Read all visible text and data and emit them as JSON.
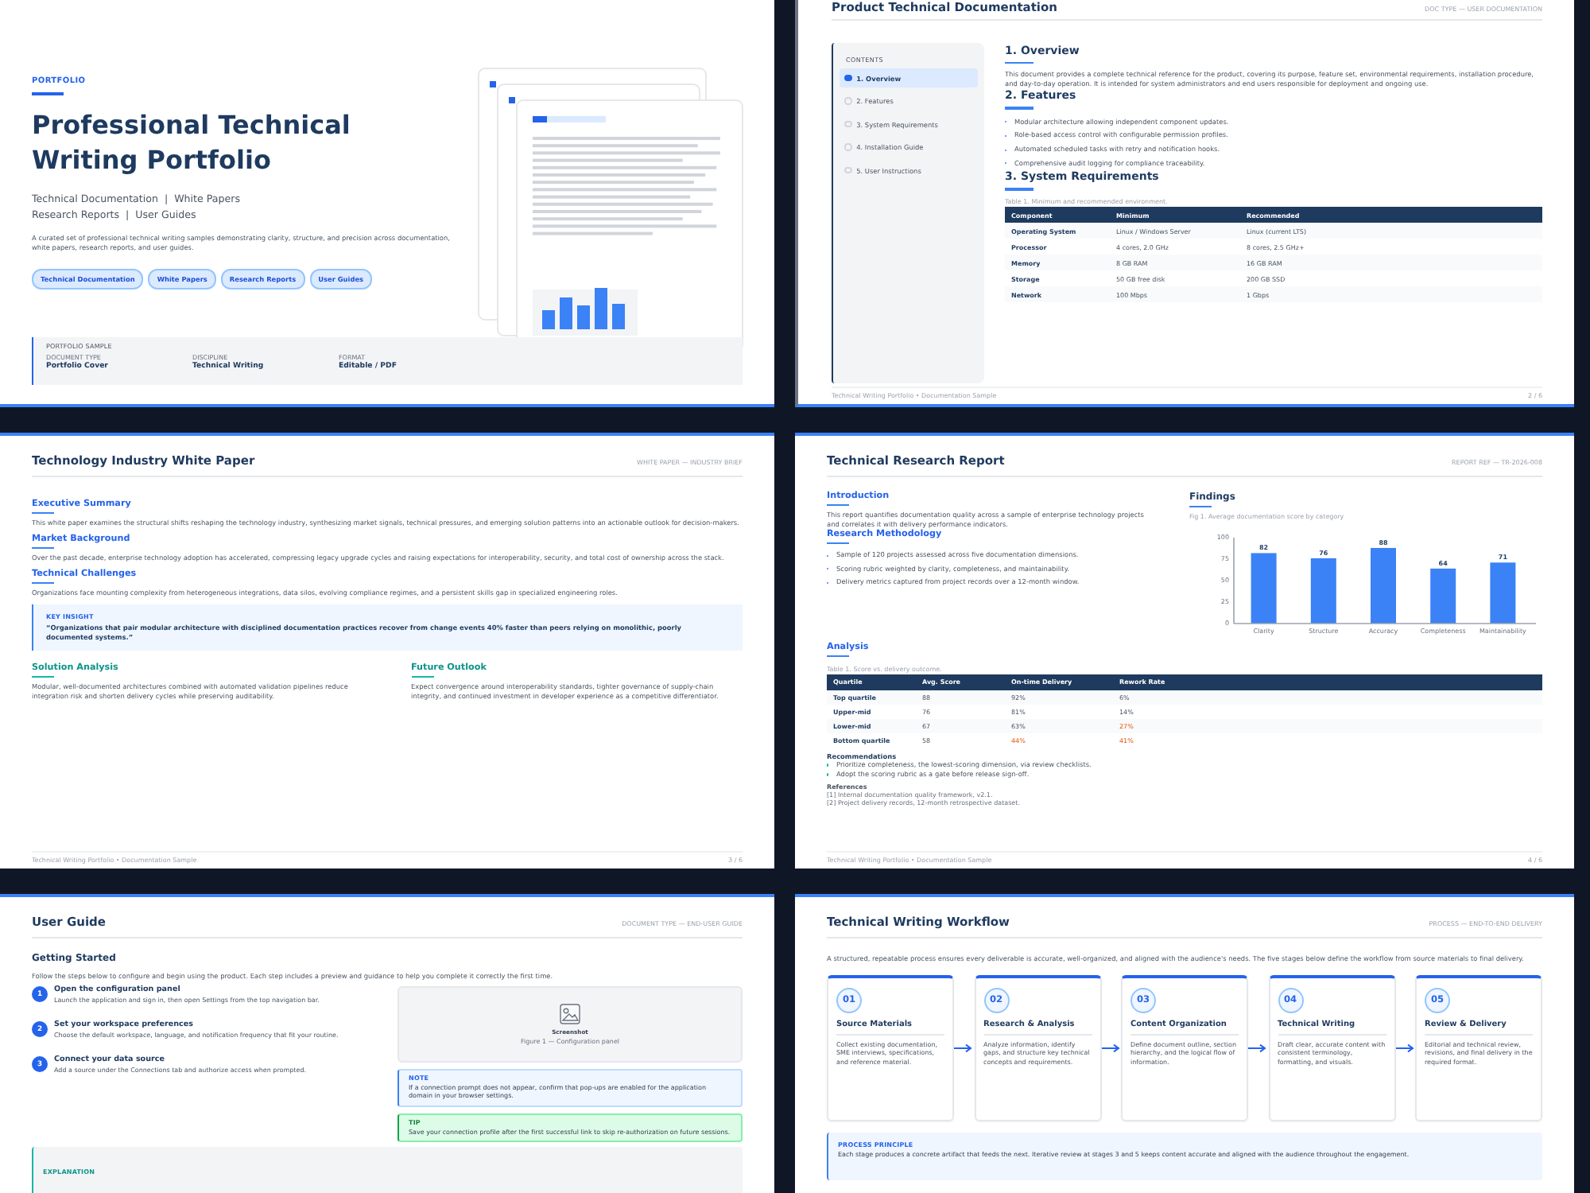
{
  "cover": {
    "eyebrow": "PORTFOLIO",
    "title": "Professional Technical Writing Portfolio",
    "subtitle_lines": [
      "Technical Documentation  |  White Papers",
      "Research Reports  |  User Guides"
    ],
    "description": "A curated set of professional technical writing samples demonstrating clarity, structure, and precision across documentation, white papers, research reports, and user guides.",
    "tags": [
      "Technical Documentation",
      "White Papers",
      "Research Reports",
      "User Guides"
    ],
    "sample": {
      "label": "PORTFOLIO SAMPLE",
      "fields": [
        {
          "label": "DOCUMENT TYPE",
          "value": "Portfolio Cover"
        },
        {
          "label": "DISCIPLINE",
          "value": "Technical Writing"
        },
        {
          "label": "FORMAT",
          "value": "Editable / PDF"
        }
      ]
    }
  },
  "doc": {
    "title": "Product Technical Documentation",
    "meta": "DOC TYPE — USER DOCUMENTATION",
    "contents_label": "CONTENTS",
    "contents": [
      {
        "label": "1. Overview",
        "selected": true
      },
      {
        "label": "2. Features",
        "selected": false
      },
      {
        "label": "3. System Requirements",
        "selected": false
      },
      {
        "label": "4. Installation Guide",
        "selected": false
      },
      {
        "label": "5. User Instructions",
        "selected": false
      }
    ],
    "overview_heading": "1. Overview",
    "overview": "This document provides a complete technical reference for the product, covering its purpose, feature set, environmental requirements, installation procedure, and day-to-day operation. It is intended for system administrators and end users responsible for deployment and ongoing use.",
    "features_heading": "2. Features",
    "features": [
      "Modular architecture allowing independent component updates.",
      "Role-based access control with configurable permission profiles.",
      "Automated scheduled tasks with retry and notification hooks.",
      "Comprehensive audit logging for compliance traceability."
    ],
    "requirements_heading": "3. System Requirements",
    "table_caption": "Table 1. Minimum and recommended environment.",
    "columns": [
      "Component",
      "Minimum",
      "Recommended"
    ],
    "rows": [
      [
        "Operating System",
        "Linux / Windows Server",
        "Linux (current LTS)"
      ],
      [
        "Processor",
        "4 cores, 2.0 GHz",
        "8 cores, 2.5 GHz+"
      ],
      [
        "Memory",
        "8 GB RAM",
        "16 GB RAM"
      ],
      [
        "Storage",
        "50 GB free disk",
        "200 GB SSD"
      ],
      [
        "Network",
        "100 Mbps",
        "1 Gbps"
      ]
    ],
    "footer": {
      "left": "Technical Writing Portfolio  •  Documentation Sample",
      "right": "2 / 6"
    }
  },
  "white_paper": {
    "title": "Technology Industry White Paper",
    "meta": "WHITE PAPER — INDUSTRY BRIEF",
    "sections": [
      {
        "heading": "Executive Summary",
        "text": "This white paper examines the structural shifts reshaping the technology industry, synthesizing market signals, technical pressures, and emerging solution patterns into an actionable outlook for decision-makers."
      },
      {
        "heading": "Market Background",
        "text": "Over the past decade, enterprise technology adoption has accelerated, compressing legacy upgrade cycles and raising expectations for interoperability, security, and total cost of ownership across the stack."
      },
      {
        "heading": "Technical Challenges",
        "text": "Organizations face mounting complexity from heterogeneous integrations, data silos, evolving compliance regimes, and a persistent skills gap in specialized engineering roles."
      }
    ],
    "insight": {
      "label": "KEY INSIGHT",
      "quote": "“Organizations that pair modular architecture with disciplined documentation practices recover from change events 40% faster than peers relying on monolithic, poorly documented systems.”"
    },
    "columns": [
      {
        "heading": "Solution Analysis",
        "text": "Modular, well-documented architectures combined with automated validation pipelines reduce integration risk and shorten delivery cycles while preserving auditability."
      },
      {
        "heading": "Future Outlook",
        "text": "Expect convergence around interoperability standards, tighter governance of supply-chain integrity, and continued investment in developer experience as a competitive differentiator."
      }
    ],
    "footer": {
      "left": "Technical Writing Portfolio  •  Documentation Sample",
      "right": "3 / 6"
    }
  },
  "report": {
    "title": "Technical Research Report",
    "meta": "REPORT REF — TR-2026-008",
    "intro_heading": "Introduction",
    "intro": "This report quantifies documentation quality across a sample of enterprise technology projects and correlates it with delivery performance indicators.",
    "method_heading": "Research Methodology",
    "method": [
      "Sample of 120 projects assessed across five documentation dimensions.",
      "Scoring rubric weighted by clarity, completeness, and maintainability.",
      "Delivery metrics captured from project records over a 12-month window."
    ],
    "findings": {
      "heading": "Findings",
      "chart_data": {
        "type": "bar",
        "title": "Fig 1. Average documentation score by category",
        "categories": [
          "Clarity",
          "Structure",
          "Accuracy",
          "Completeness",
          "Maintainability"
        ],
        "values": [
          82,
          76,
          88,
          64,
          71
        ],
        "ylim": [
          0,
          100
        ],
        "yticks": [
          0,
          25,
          50,
          75,
          100
        ],
        "data_labels": true
      }
    },
    "analysis": {
      "heading": "Analysis",
      "caption": "Table 1. Score vs. delivery outcome.",
      "columns": [
        "Quartile",
        "Avg. Score",
        "On-time Delivery",
        "Rework Rate"
      ],
      "rows": [
        [
          {
            "text": "Top quartile",
            "flagged": false
          },
          {
            "text": "88",
            "flagged": false
          },
          {
            "text": "92%",
            "flagged": false
          },
          {
            "text": "6%",
            "flagged": false
          }
        ],
        [
          {
            "text": "Upper-mid",
            "flagged": false
          },
          {
            "text": "76",
            "flagged": false
          },
          {
            "text": "81%",
            "flagged": false
          },
          {
            "text": "14%",
            "flagged": false
          }
        ],
        [
          {
            "text": "Lower-mid",
            "flagged": false
          },
          {
            "text": "67",
            "flagged": false
          },
          {
            "text": "63%",
            "flagged": false
          },
          {
            "text": "27%",
            "flagged": true
          }
        ],
        [
          {
            "text": "Bottom quartile",
            "flagged": false
          },
          {
            "text": "58",
            "flagged": false
          },
          {
            "text": "44%",
            "flagged": true
          },
          {
            "text": "41%",
            "flagged": true
          }
        ]
      ]
    },
    "recommendations_heading": "Recommendations",
    "recommendations": [
      "Prioritize completeness, the lowest-scoring dimension, via review checklists.",
      "Adopt the scoring rubric as a gate before release sign-off."
    ],
    "references_heading": "References",
    "references": [
      "[1] Internal documentation quality framework, v2.1.",
      "[2] Project delivery records, 12-month retrospective dataset."
    ],
    "footer": {
      "left": "Technical Writing Portfolio  •  Documentation Sample",
      "right": "4 / 6"
    }
  },
  "user_guide": {
    "title": "User Guide",
    "meta": "DOCUMENT TYPE — END-USER GUIDE",
    "heading": "Getting Started",
    "intro": "Follow the steps below to configure and begin using the product. Each step includes a preview and guidance to help you complete it correctly the first time.",
    "steps": [
      {
        "number": "1",
        "title": "Open the configuration panel",
        "text": "Launch the application and sign in, then open Settings from the top navigation bar."
      },
      {
        "number": "2",
        "title": "Set your workspace preferences",
        "text": "Choose the default workspace, language, and notification frequency that fit your routine."
      },
      {
        "number": "3",
        "title": "Connect your data source",
        "text": "Add a source under the Connections tab and authorize access when prompted."
      }
    ],
    "screenshot": {
      "label": "Screenshot",
      "caption": "Figure 1 — Configuration panel"
    },
    "callouts": [
      {
        "kind": "note",
        "label": "NOTE",
        "text": "If a connection prompt does not appear, confirm that pop-ups are enabled for the application domain in your browser settings."
      },
      {
        "kind": "tip",
        "label": "TIP",
        "text": "Save your connection profile after the first successful link to skip re-authorization on future sessions."
      }
    ],
    "explanation_label": "EXPLANATION"
  },
  "workflow": {
    "title": "Technical Writing Workflow",
    "meta": "PROCESS — END-TO-END DELIVERY",
    "intro": "A structured, repeatable process ensures every deliverable is accurate, well-organized, and aligned with the audience's needs. The five stages below define the workflow from source materials to final delivery.",
    "stages": [
      {
        "number": "01",
        "title": "Source Materials",
        "text": "Collect existing documentation, SME interviews, specifications, and reference material."
      },
      {
        "number": "02",
        "title": "Research & Analysis",
        "text": "Analyze information, identify gaps, and structure key technical concepts and requirements."
      },
      {
        "number": "03",
        "title": "Content Organization",
        "text": "Define document outline, section hierarchy, and the logical flow of information."
      },
      {
        "number": "04",
        "title": "Technical Writing",
        "text": "Draft clear, accurate content with consistent terminology, formatting, and visuals."
      },
      {
        "number": "05",
        "title": "Review & Delivery",
        "text": "Editorial and technical review, revisions, and final delivery in the required format."
      }
    ],
    "principle": {
      "label": "PROCESS PRINCIPLE",
      "text": "Each stage produces a concrete artifact that feeds the next. Iterative review at stages 3 and 5 keeps content accurate and aligned with the audience throughout the engagement."
    }
  }
}
